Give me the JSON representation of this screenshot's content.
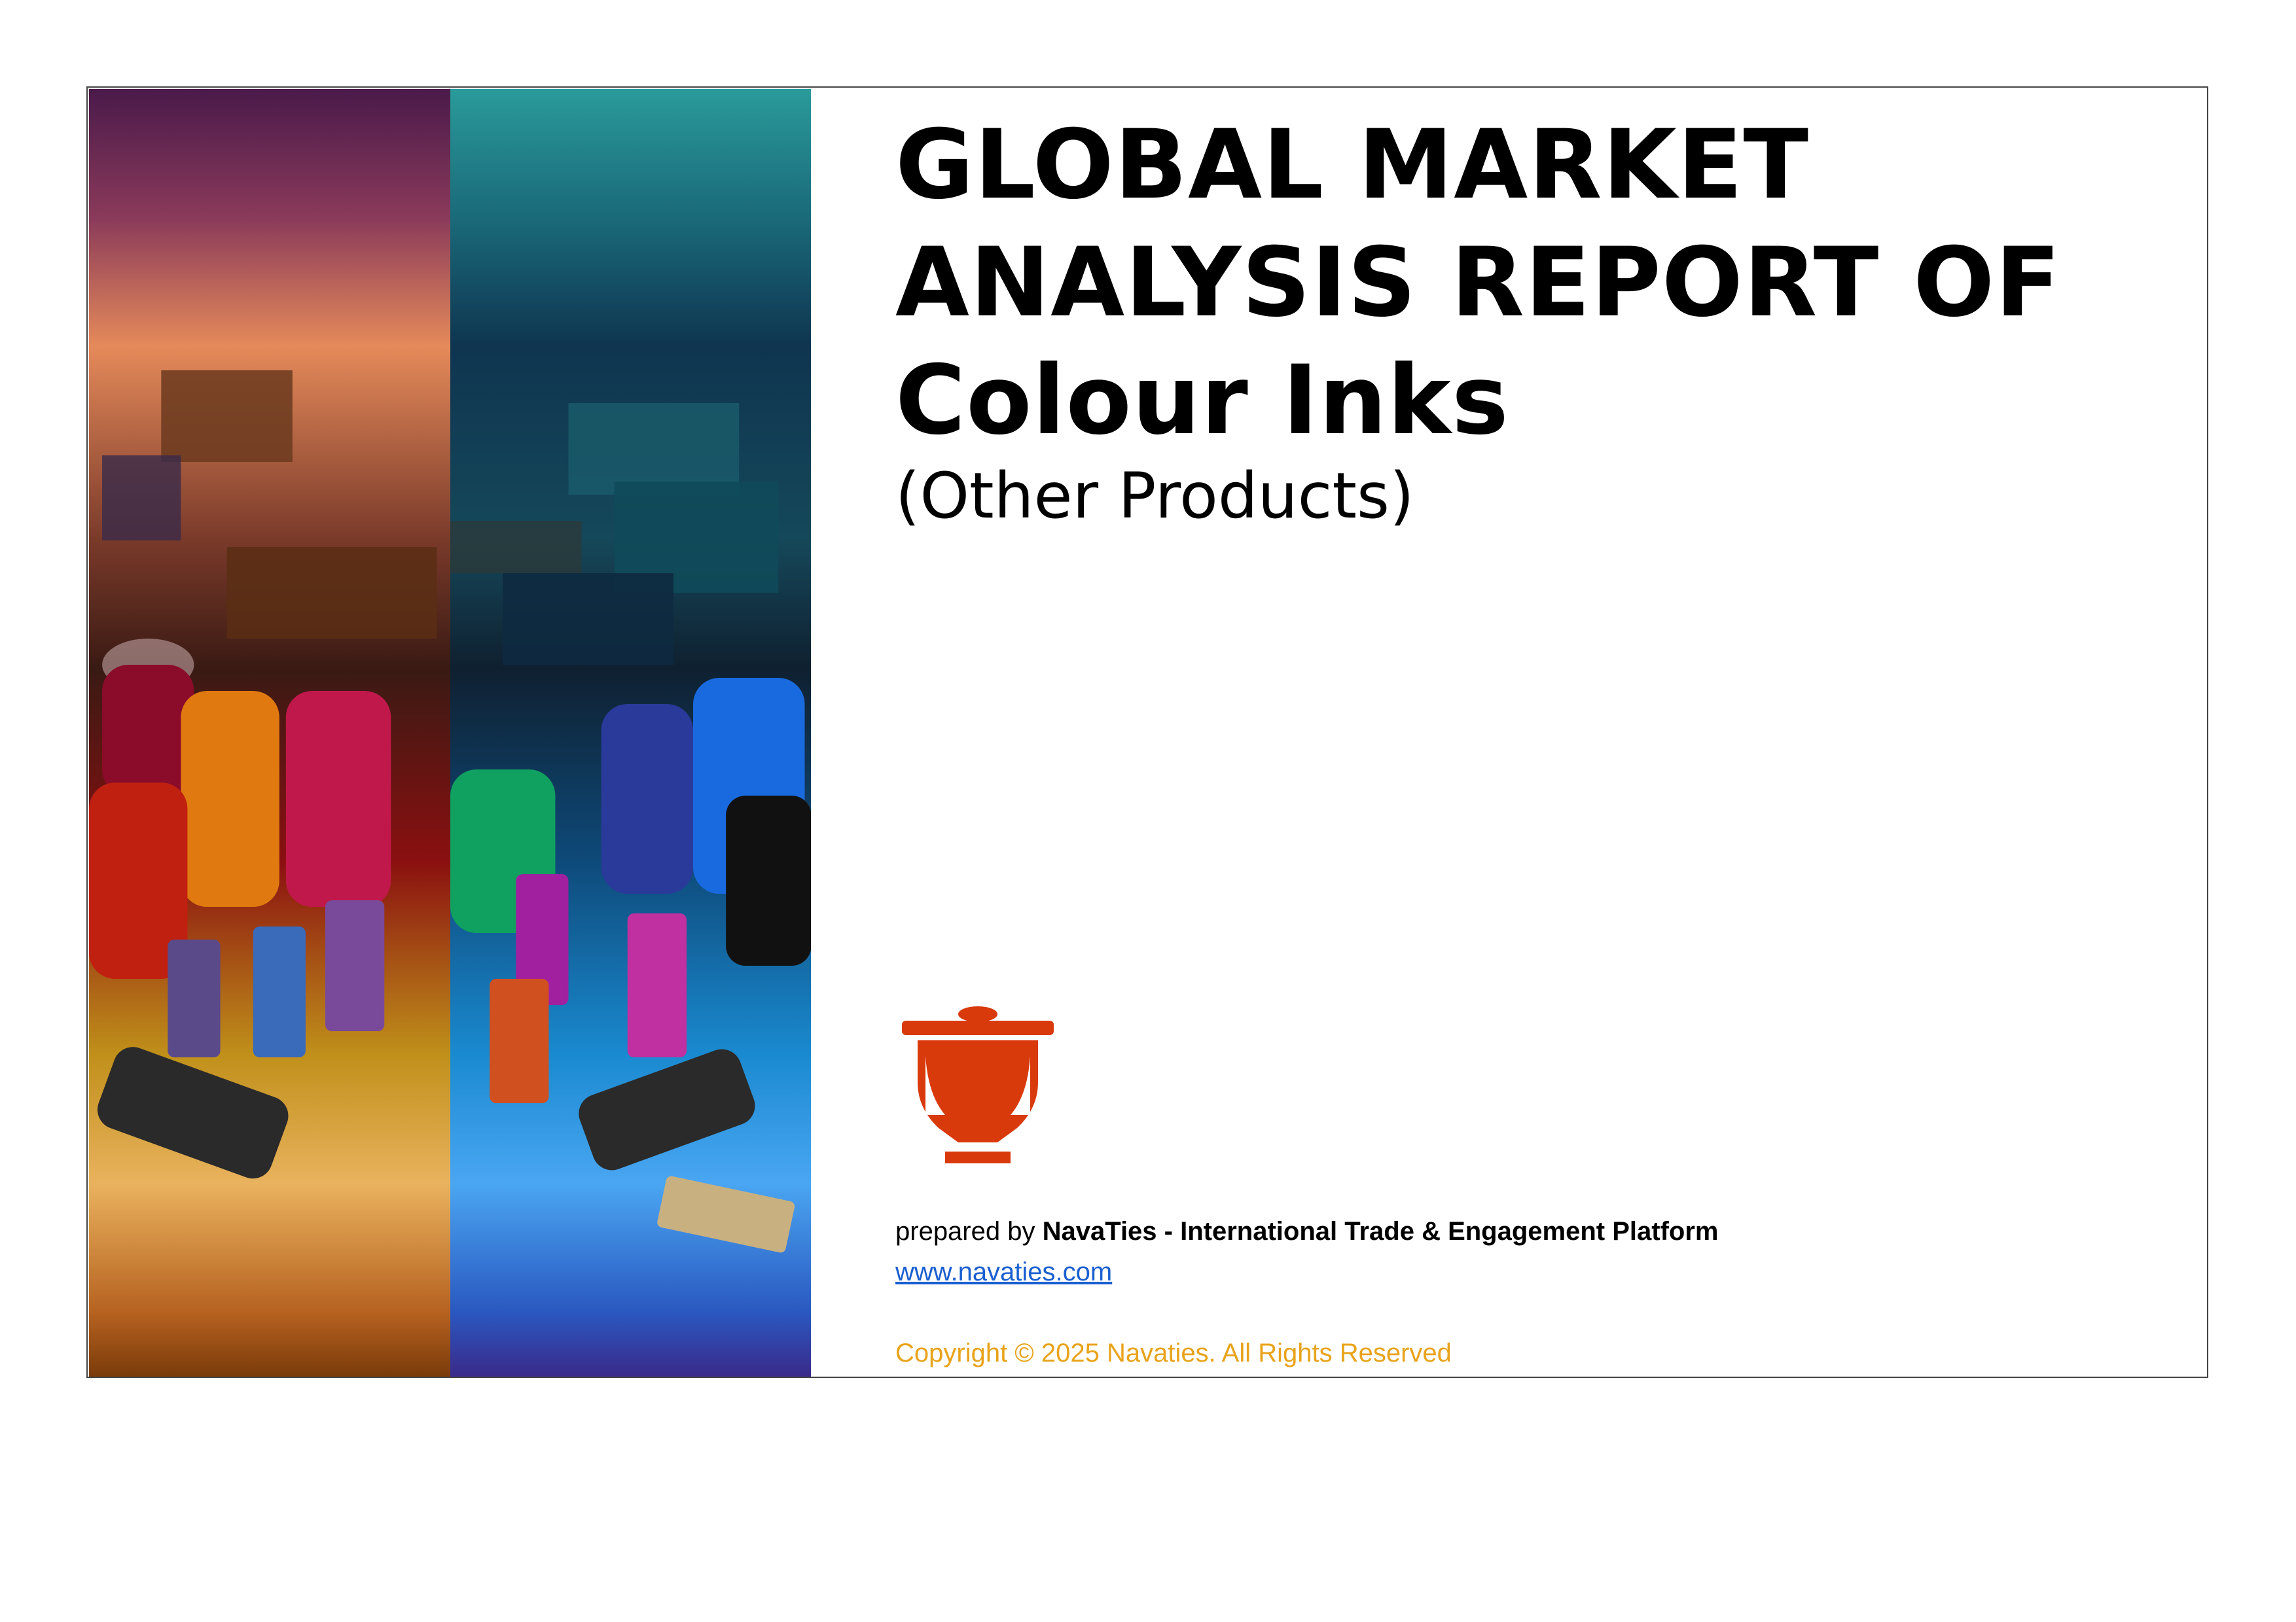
{
  "title": {
    "line1": "GLOBAL MARKET",
    "line2": "ANALYSIS REPORT OF",
    "line3": "Colour Inks",
    "subtitle": "(Other Products)"
  },
  "cover_image": {
    "description_icon": "ink-bottles-illustration"
  },
  "logo": {
    "icon": "navaties-logo-icon",
    "color": "#d93a0c"
  },
  "footer": {
    "prepared_prefix": "prepared by",
    "prepared_org": "NavaTies - International Trade & Engagement Platform",
    "website": "www.navaties.com",
    "copyright": "Copyright © 2025 Navaties. All Rights Reserved",
    "copyright_color": "#e8a31a",
    "link_color": "#1a5fd0"
  }
}
